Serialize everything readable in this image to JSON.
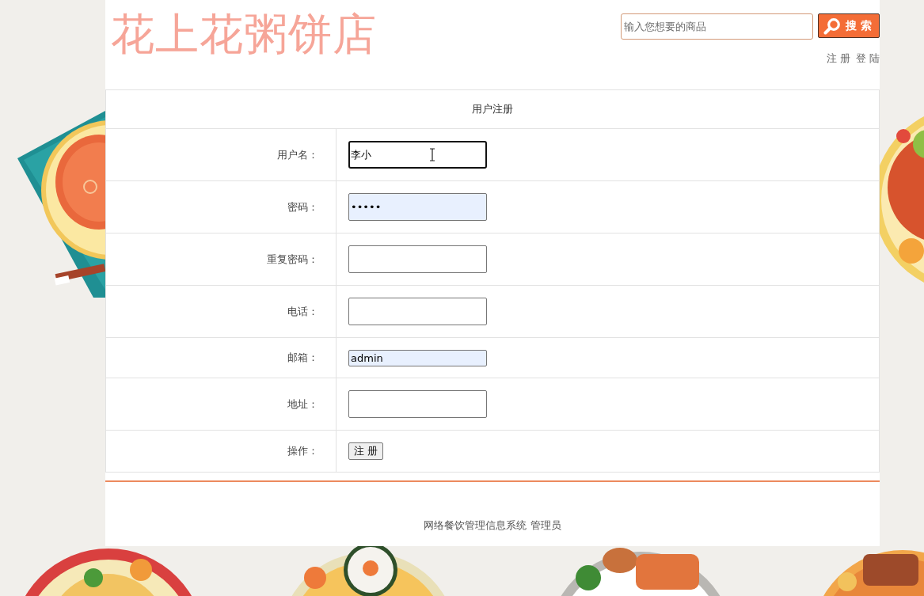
{
  "header": {
    "logo": "花上花粥饼店",
    "search": {
      "placeholder": "输入您想要的商品",
      "button": "搜 索"
    },
    "links": [
      "注 册",
      "登 陆"
    ]
  },
  "form": {
    "title": "用户注册",
    "rows": [
      {
        "kind": "input",
        "label": "用户名：",
        "field": {
          "value": "李小",
          "focused": true,
          "autofilled": false
        }
      },
      {
        "kind": "input",
        "label": "密码：",
        "field": {
          "value": "•••••",
          "focused": false,
          "autofilled": true
        }
      },
      {
        "kind": "input",
        "label": "重复密码：",
        "field": {
          "focused": false,
          "autofilled": false
        }
      },
      {
        "kind": "input",
        "label": "电话：",
        "field": {
          "focused": false,
          "autofilled": false
        }
      },
      {
        "kind": "compact",
        "label": "邮箱：",
        "field": {
          "value": "admin",
          "focused": false,
          "autofilled": true
        }
      },
      {
        "kind": "input",
        "label": "地址：",
        "field": {
          "focused": false,
          "autofilled": false
        }
      },
      {
        "kind": "button",
        "label": "操作：",
        "button": "注 册"
      }
    ]
  },
  "footer": {
    "text": "网络餐饮管理信息系统 管理员"
  }
}
